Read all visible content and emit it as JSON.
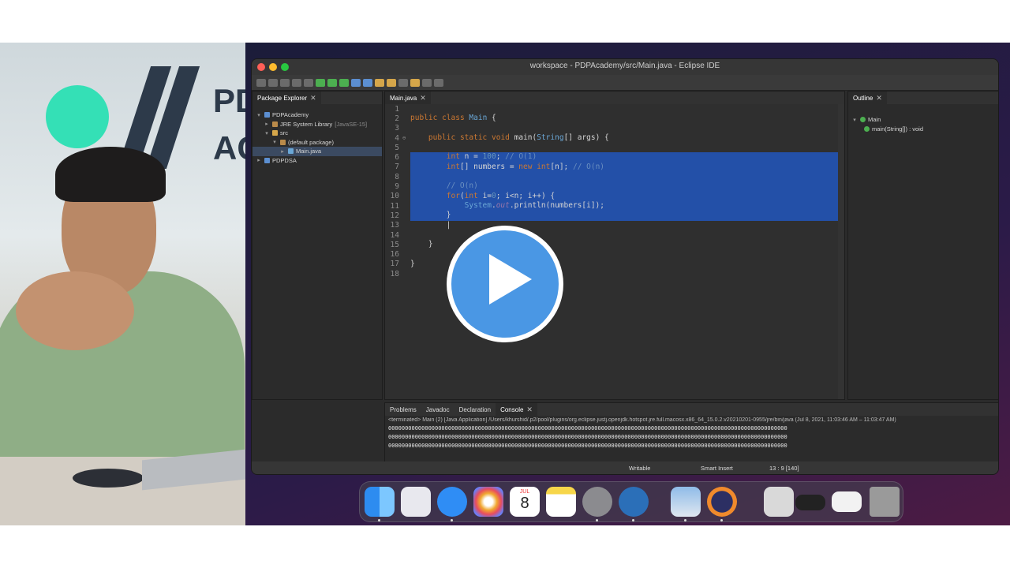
{
  "window": {
    "title": "workspace - PDPAcademy/src/Main.java - Eclipse IDE"
  },
  "package_explorer": {
    "tab_label": "Package Explorer",
    "tree": [
      {
        "label": "PDPAcademy",
        "extra": "",
        "indent": 0,
        "twisty": "▾"
      },
      {
        "label": "JRE System Library",
        "extra": "[JavaSE-15]",
        "indent": 1,
        "twisty": "▸"
      },
      {
        "label": "src",
        "extra": "",
        "indent": 1,
        "twisty": "▾"
      },
      {
        "label": "(default package)",
        "extra": "",
        "indent": 2,
        "twisty": "▾"
      },
      {
        "label": "Main.java",
        "extra": "",
        "indent": 3,
        "twisty": "▸",
        "selected": true
      },
      {
        "label": "PDPDSA",
        "extra": "",
        "indent": 0,
        "twisty": "▸"
      }
    ]
  },
  "editor": {
    "tab_label": "Main.java",
    "lines": [
      {
        "n": "1",
        "text": ""
      },
      {
        "n": "2",
        "text": "public class Main {"
      },
      {
        "n": "3",
        "text": ""
      },
      {
        "n": "4",
        "text": "    public static void main(String[] args) {",
        "marker": "⊖"
      },
      {
        "n": "5",
        "text": ""
      },
      {
        "n": "6",
        "text": "        int n = 100; // O(1)",
        "hl": true
      },
      {
        "n": "7",
        "text": "        int[] numbers = new int[n]; // O(n)",
        "hl": true
      },
      {
        "n": "8",
        "text": "",
        "hl": true
      },
      {
        "n": "9",
        "text": "        // O(n)",
        "hl": true
      },
      {
        "n": "10",
        "text": "        for(int i=0; i<n; i++) {",
        "hl": true
      },
      {
        "n": "11",
        "text": "            System.out.println(numbers[i]);",
        "hl": true
      },
      {
        "n": "12",
        "text": "        }",
        "hl": true
      },
      {
        "n": "13",
        "text": "        |",
        "hl": false
      },
      {
        "n": "14",
        "text": ""
      },
      {
        "n": "15",
        "text": "    }"
      },
      {
        "n": "16",
        "text": ""
      },
      {
        "n": "17",
        "text": "}"
      },
      {
        "n": "18",
        "text": ""
      }
    ]
  },
  "outline": {
    "tab_label": "Outline",
    "items": [
      "Main",
      "main(String[]) : void"
    ]
  },
  "console": {
    "tabs": [
      "Problems",
      "Javadoc",
      "Declaration",
      "Console"
    ],
    "header": "<terminated> Main (2) [Java Application] /Users/khurshid/.p2/pool/plugins/org.eclipse.justj.openjdk.hotspot.jre.full.macosx.x86_64_15.0.2.v20210201-0955/jre/bin/java  (Jul 8, 2021, 11:03:46 AM – 11:03:47 AM)",
    "output_line": "000000000000000000000000000000000000000000000000000000000000000000000000000000000000000000000000000000000000000000000000"
  },
  "status": {
    "writable": "Writable",
    "insert_mode": "Smart Insert",
    "position": "13 : 9 [140]"
  },
  "dock": {
    "calendar_month": "JUL",
    "calendar_day": "8"
  },
  "webcam": {
    "brand_text_line1": "PD",
    "brand_text_line2": "AC"
  },
  "colors": {
    "play_button": "#4a97e4",
    "selection": "#2350a8",
    "brand_green": "#34e0b6"
  }
}
